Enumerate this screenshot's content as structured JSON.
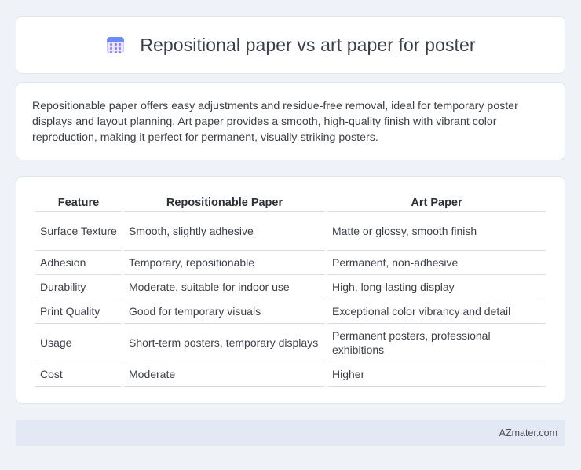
{
  "header": {
    "title": "Repositional paper vs art paper for poster",
    "icon": "calendar-icon"
  },
  "intro": {
    "text": "Repositionable paper offers easy adjustments and residue-free removal, ideal for temporary poster displays and layout planning. Art paper provides a smooth, high-quality finish with vibrant color reproduction, making it perfect for permanent, visually striking posters."
  },
  "table": {
    "headers": [
      "Feature",
      "Repositionable Paper",
      "Art Paper"
    ],
    "rows": [
      [
        "Surface Texture",
        "Smooth, slightly adhesive",
        "Matte or glossy, smooth finish"
      ],
      [
        "Adhesion",
        "Temporary, repositionable",
        "Permanent, non-adhesive"
      ],
      [
        "Durability",
        "Moderate, suitable for indoor use",
        "High, long-lasting display"
      ],
      [
        "Print Quality",
        "Good for temporary visuals",
        "Exceptional color vibrancy and detail"
      ],
      [
        "Usage",
        "Short-term posters, temporary displays",
        "Permanent posters, professional exhibitions"
      ],
      [
        "Cost",
        "Moderate",
        "Higher"
      ]
    ]
  },
  "footer": {
    "brand": "AZmater.com"
  },
  "colors": {
    "background": "#eff3f8",
    "card": "#ffffff",
    "footer": "#e2e9f5",
    "icon_accent": "#6c8cf5"
  }
}
